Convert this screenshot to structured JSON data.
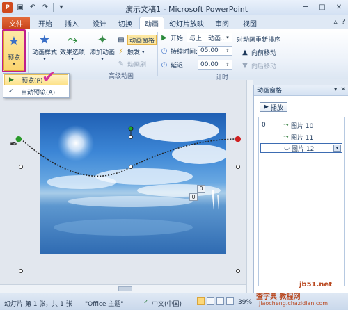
{
  "titlebar": {
    "logo": "P",
    "title": "演示文稿1 - Microsoft PowerPoint",
    "qat_icons": [
      "save-icon",
      "undo-icon",
      "redo-icon",
      "customize-icon"
    ]
  },
  "tabs": [
    "文件",
    "开始",
    "插入",
    "设计",
    "切换",
    "动画",
    "幻灯片放映",
    "审阅",
    "视图"
  ],
  "ribbon": {
    "preview_label": "预览",
    "animation_style_label": "动画样式",
    "effect_options_label": "效果选项",
    "add_animation_label": "添加动画",
    "animation_pane_label": "动画窗格",
    "trigger_label": "触发",
    "animation_painter_label": "动画刷",
    "advanced_group_label": "高级动画",
    "start_label": "开始:",
    "start_value": "与上一动画...",
    "duration_label": "持续时间:",
    "duration_value": "05.00",
    "delay_label": "延迟:",
    "delay_value": "00.00",
    "timing_group_label": "计时",
    "reorder_label": "对动画重新排序",
    "move_earlier_label": "向前移动",
    "move_later_label": "向后移动"
  },
  "menu": {
    "preview_item": "预览(P)",
    "autopreview_item": "自动预览(A)"
  },
  "slide": {
    "label_0a": "0",
    "label_0b": "0"
  },
  "pane": {
    "title": "动画窗格",
    "play_label": "播放",
    "items": [
      {
        "num": "0",
        "name": "图片 10"
      },
      {
        "num": "",
        "name": "图片 11"
      },
      {
        "num": "",
        "name": "图片 12"
      }
    ]
  },
  "status": {
    "slide_info": "幻灯片 第 1 张，共 1 张",
    "theme": "\"Office 主题\"",
    "language": "中文(中国)",
    "zoom": "39%"
  },
  "watermark": {
    "line1": "查字典 教程网",
    "line2": "jiaocheng.chazidian.com",
    "site": "jb51.net"
  },
  "colors": {
    "file_tab": "#c8451a",
    "highlight": "#fde28a",
    "annotation": "#c0208a"
  }
}
